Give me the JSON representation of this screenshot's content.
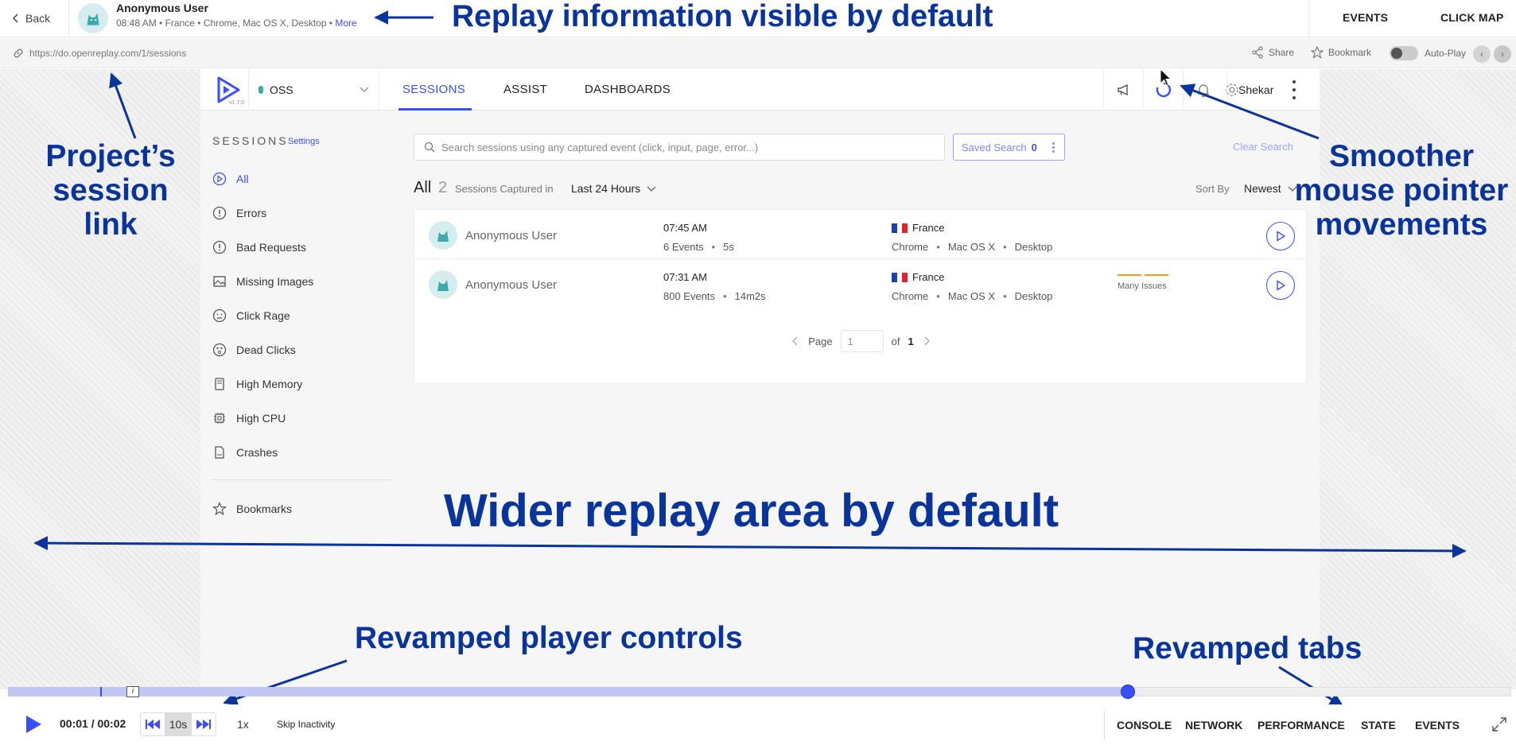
{
  "replay_header": {
    "back_label": "Back",
    "user_name": "Anonymous User",
    "meta_prefix": "08:48 AM • France • Chrome, Mac OS X, Desktop •",
    "more_label": "More",
    "tabs": [
      "EVENTS",
      "CLICK MAP"
    ]
  },
  "url_bar": {
    "url": "https://do.openreplay.com/1/sessions",
    "share_label": "Share",
    "bookmark_label": "Bookmark",
    "autoplay_label": "Auto-Play"
  },
  "app": {
    "version": "v1.7.0",
    "project": "OSS",
    "tabs": [
      "SESSIONS",
      "ASSIST",
      "DASHBOARDS"
    ],
    "user": "Shekar"
  },
  "sidebar": {
    "title": "SESSIONS",
    "settings_label": "Settings",
    "items": [
      {
        "label": "All",
        "icon": "play-circle-icon"
      },
      {
        "label": "Errors",
        "icon": "exclamation-circle-icon"
      },
      {
        "label": "Bad Requests",
        "icon": "exclamation-circle-icon"
      },
      {
        "label": "Missing Images",
        "icon": "image-icon"
      },
      {
        "label": "Click Rage",
        "icon": "angry-face-icon"
      },
      {
        "label": "Dead Clicks",
        "icon": "dead-face-icon"
      },
      {
        "label": "High Memory",
        "icon": "memory-icon"
      },
      {
        "label": "High CPU",
        "icon": "cpu-icon"
      },
      {
        "label": "Crashes",
        "icon": "file-crash-icon"
      }
    ],
    "bookmarks_label": "Bookmarks"
  },
  "search": {
    "placeholder": "Search sessions using any captured event (click, input, page, error...)",
    "saved_label": "Saved Search",
    "saved_count": "0",
    "clear_label": "Clear Search"
  },
  "list": {
    "all_label": "All",
    "count": "2",
    "captured_label": "Sessions Captured in",
    "period": "Last 24 Hours",
    "sort_label": "Sort By",
    "sort_value": "Newest"
  },
  "sessions": [
    {
      "user": "Anonymous User",
      "time": "07:45 AM",
      "events": "6 Events",
      "duration": "5s",
      "country": "France",
      "browser": "Chrome",
      "os": "Mac OS X",
      "device": "Desktop",
      "issues": ""
    },
    {
      "user": "Anonymous User",
      "time": "07:31 AM",
      "events": "800 Events",
      "duration": "14m2s",
      "country": "France",
      "browser": "Chrome",
      "os": "Mac OS X",
      "device": "Desktop",
      "issues": "Many Issues"
    }
  ],
  "pager": {
    "page_label": "Page",
    "current": "1",
    "of_label": "of",
    "total": "1"
  },
  "annotations": {
    "replay_info": "Replay information visible by default",
    "session_link": [
      "Project’s",
      "session",
      "link"
    ],
    "pointer": [
      "Smoother",
      "mouse pointer",
      "movements"
    ],
    "wider": "Wider replay area by default",
    "player_controls": "Revamped player controls",
    "tabs": "Revamped tabs"
  },
  "player": {
    "time": "00:01 / 00:02",
    "skip_value": "10s",
    "speed": "1x",
    "skip_inactivity": "Skip Inactivity",
    "progress": 0.745,
    "tabs": [
      "CONSOLE",
      "NETWORK",
      "PERFORMANCE",
      "STATE",
      "EVENTS"
    ]
  },
  "colors": {
    "accent": "#394eff",
    "annotation": "#08349c",
    "teal": "#3eaaaf",
    "warning": "#f59e0b"
  }
}
